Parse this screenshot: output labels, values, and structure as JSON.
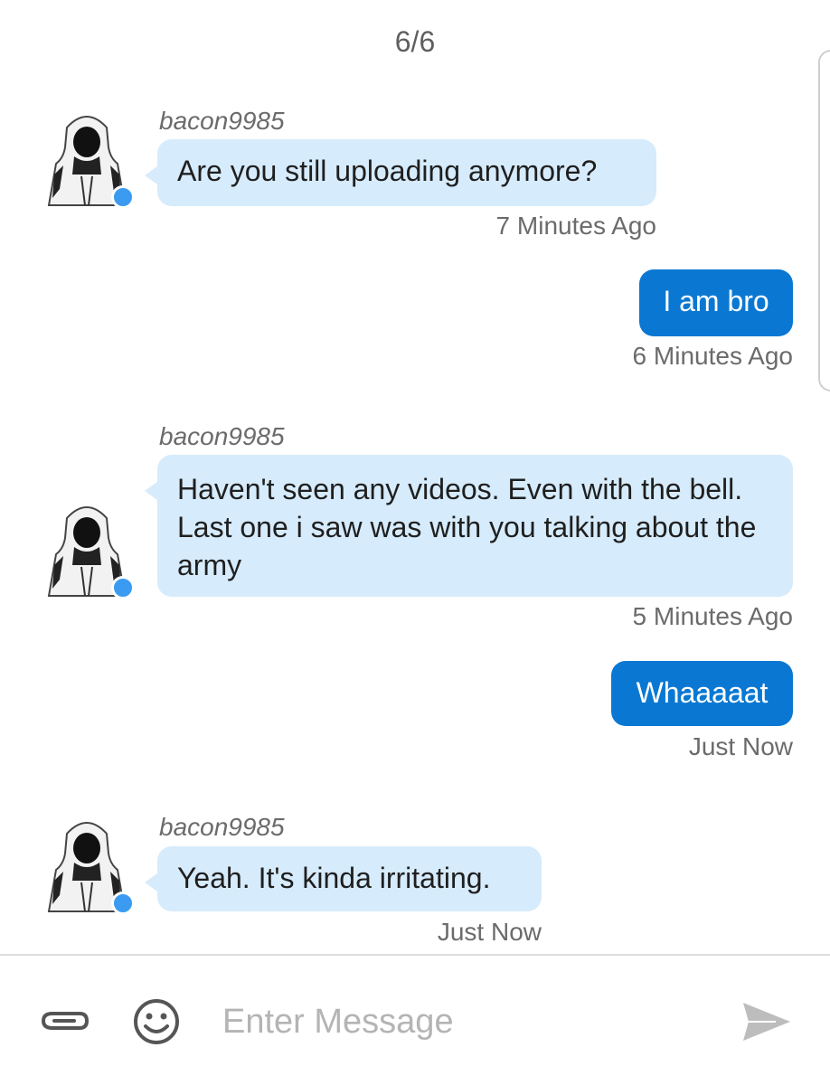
{
  "header": {
    "page_indicator": "6/6"
  },
  "conversation": {
    "messages": [
      {
        "direction": "in",
        "sender": "bacon9985",
        "text": "Are you still uploading anymore?",
        "time": "7 Minutes Ago"
      },
      {
        "direction": "out",
        "text": "I am bro",
        "time": "6 Minutes Ago"
      },
      {
        "direction": "in",
        "sender": "bacon9985",
        "text": "Haven't seen any videos. Even with the bell. Last one i saw was with you talking about the army",
        "time": "5 Minutes Ago"
      },
      {
        "direction": "out",
        "text": "Whaaaaat",
        "time": "Just Now"
      },
      {
        "direction": "in",
        "sender": "bacon9985",
        "text": "Yeah. It's kinda irritating.",
        "time": "Just Now"
      }
    ]
  },
  "composer": {
    "placeholder": "Enter Message",
    "attach_icon": "paperclip-icon",
    "emoji_icon": "smiley-icon",
    "send_icon": "send-icon"
  },
  "colors": {
    "incoming_bubble": "#d6ebfb",
    "outgoing_bubble": "#0a78d2",
    "online_dot": "#3b9bf0"
  }
}
